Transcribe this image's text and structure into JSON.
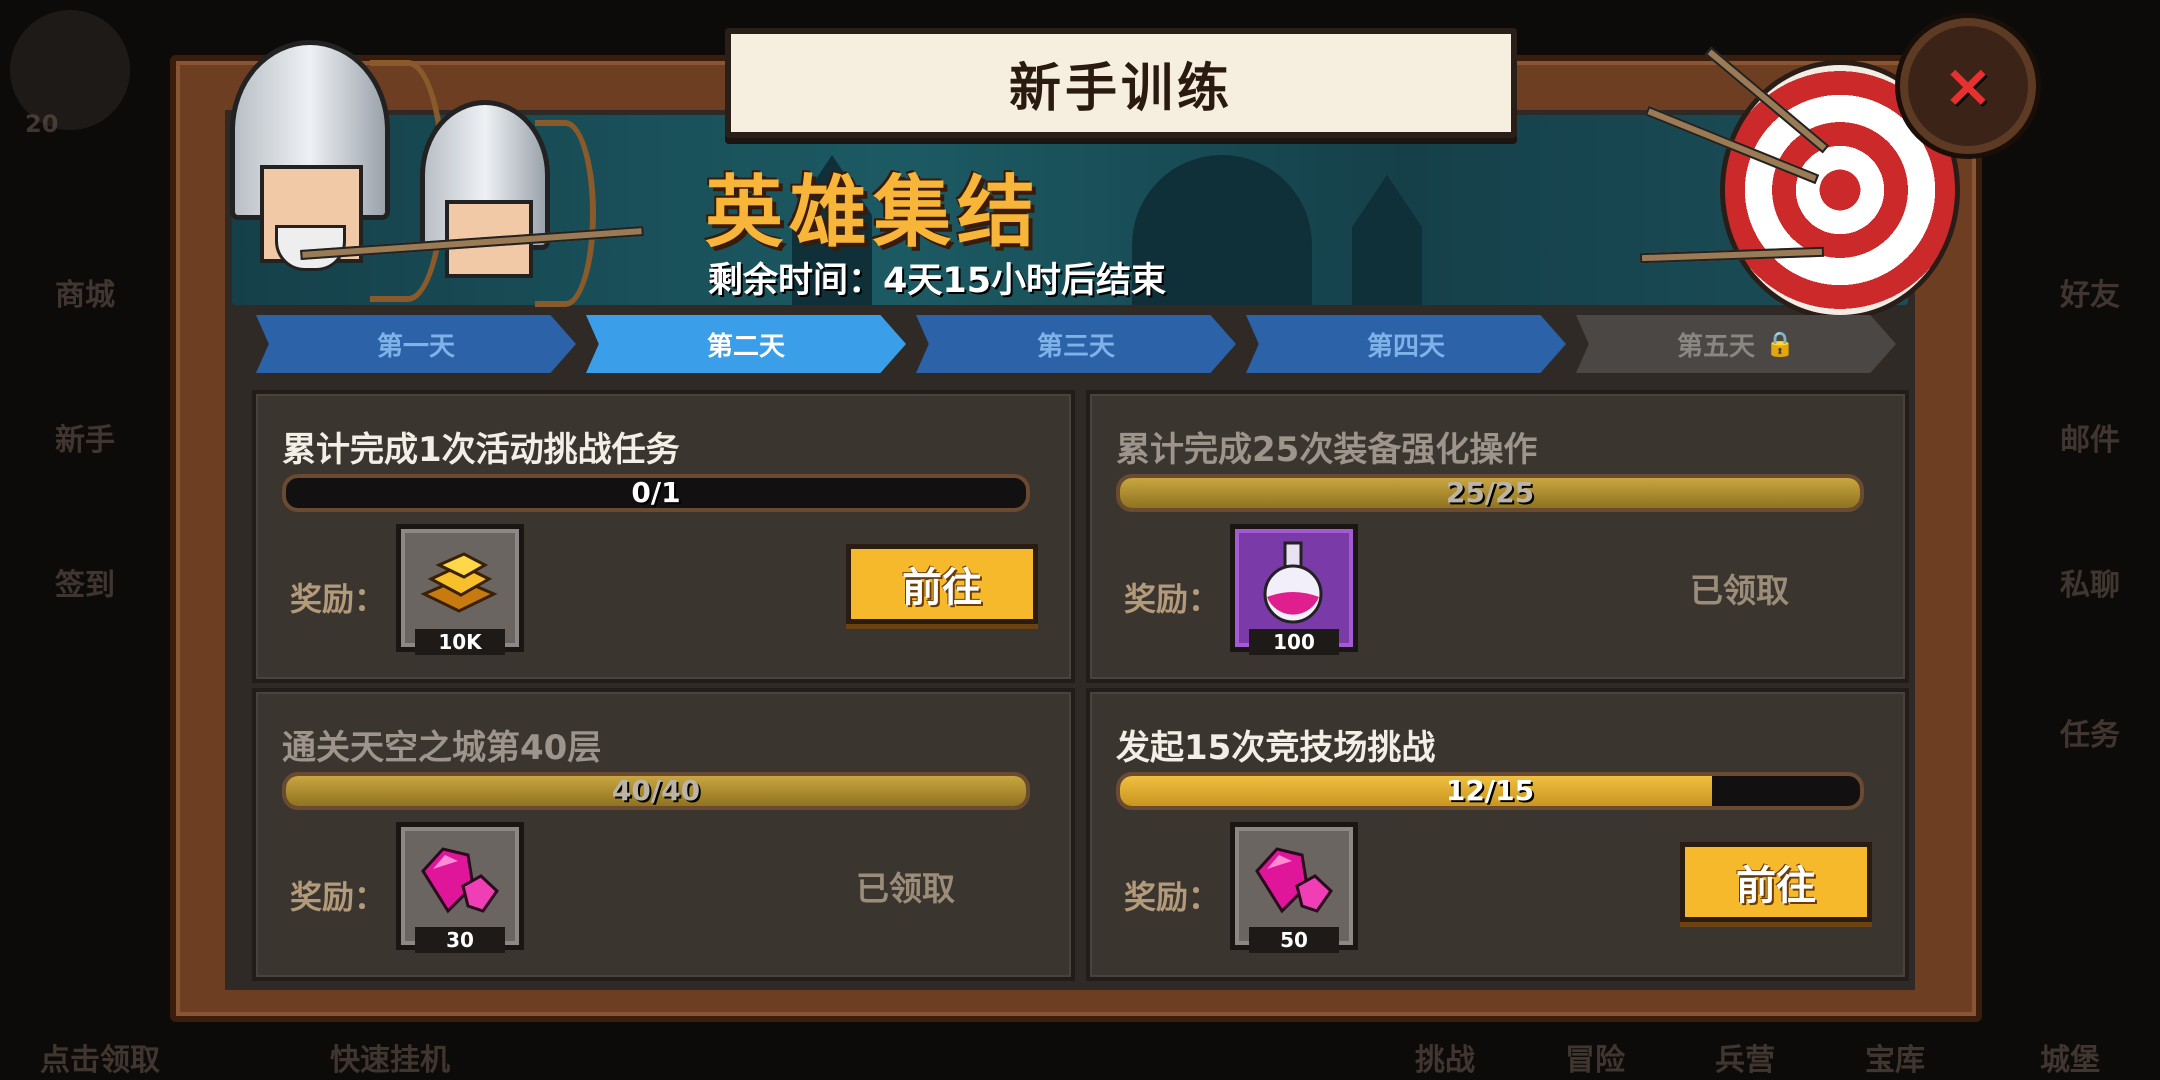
{
  "modal": {
    "title": "新手训练",
    "close_symbol": "×"
  },
  "event": {
    "title": "英雄集结",
    "remaining": "剩余时间：4天15小时后结束"
  },
  "tabs": [
    {
      "label": "第一天",
      "state": "normal"
    },
    {
      "label": "第二天",
      "state": "active"
    },
    {
      "label": "第三天",
      "state": "normal"
    },
    {
      "label": "第四天",
      "state": "normal"
    },
    {
      "label": "第五天",
      "state": "locked"
    }
  ],
  "tasks": [
    {
      "title": "累计完成1次活动挑战任务",
      "progress_text": "0/1",
      "progress": 0,
      "reward_label": "奖励：",
      "reward_icon": "gold-bars-icon",
      "reward_qty": "10K",
      "action": "前往",
      "status": "active"
    },
    {
      "title": "累计完成25次装备强化操作",
      "progress_text": "25/25",
      "progress": 1,
      "reward_label": "奖励：",
      "reward_icon": "potion-icon",
      "reward_qty": "100",
      "action": "已领取",
      "status": "claimed"
    },
    {
      "title": "通关天空之城第40层",
      "progress_text": "40/40",
      "progress": 1,
      "reward_label": "奖励：",
      "reward_icon": "gem-icon",
      "reward_qty": "30",
      "action": "已领取",
      "status": "claimed"
    },
    {
      "title": "发起15次竞技场挑战",
      "progress_text": "12/15",
      "progress": 0.8,
      "reward_label": "奖励：",
      "reward_icon": "gem-icon",
      "reward_qty": "50",
      "action": "前往",
      "status": "active"
    }
  ],
  "background": {
    "left_labels": [
      "商城",
      "新手",
      "签到",
      "点击领取"
    ],
    "right_labels": [
      "好友",
      "邮件",
      "私聊",
      "任务",
      "城堡"
    ],
    "bottom_labels": [
      "快速挂机",
      "挑战",
      "冒险",
      "兵营",
      "宝库"
    ],
    "level_badge": "20"
  },
  "colors": {
    "accent_gold": "#f7b53a",
    "tab_active": "#3b9ee8",
    "go_button": "#f7b92c"
  }
}
